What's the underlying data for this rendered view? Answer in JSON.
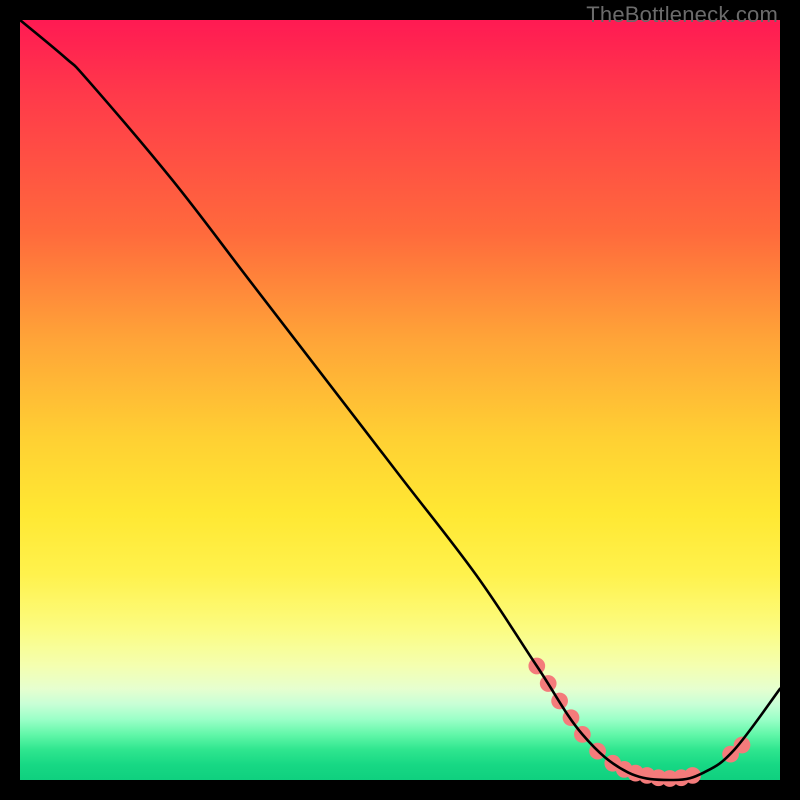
{
  "watermark": "TheBottleneck.com",
  "chart_data": {
    "type": "line",
    "title": "",
    "xlabel": "",
    "ylabel": "",
    "xlim": [
      0,
      100
    ],
    "ylim": [
      0,
      100
    ],
    "grid": false,
    "series": [
      {
        "name": "curve",
        "x": [
          0,
          6,
          9,
          20,
          30,
          40,
          50,
          60,
          68,
          74,
          80,
          86,
          90,
          94,
          100
        ],
        "y": [
          100,
          95,
          92,
          79,
          66,
          53,
          40,
          27,
          15,
          6,
          1,
          0,
          1,
          4,
          12
        ],
        "color": "#000000"
      }
    ],
    "markers": {
      "name": "dots",
      "color": "#f47b7b",
      "radius_pct": 1.1,
      "x": [
        68.0,
        69.5,
        71.0,
        72.5,
        74.0,
        76.0,
        78.0,
        79.5,
        81.0,
        82.5,
        84.0,
        85.5,
        87.0,
        88.5,
        93.5,
        95.0
      ],
      "y": [
        15.0,
        12.7,
        10.4,
        8.2,
        6.0,
        3.8,
        2.2,
        1.4,
        0.9,
        0.6,
        0.3,
        0.2,
        0.3,
        0.6,
        3.4,
        4.6
      ]
    }
  }
}
